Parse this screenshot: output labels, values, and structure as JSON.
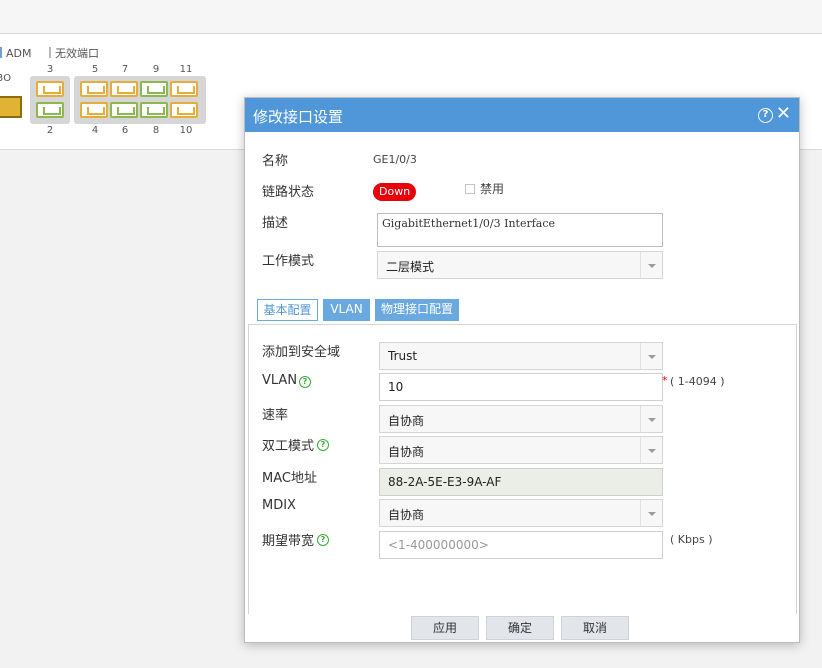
{
  "background": {
    "legend": {
      "adm": "ADM",
      "invalid_port": "无效端口",
      "partial_label": "3O"
    },
    "top_numbers": [
      "3",
      "5",
      "7",
      "9",
      "11"
    ],
    "bottom_numbers": [
      "2",
      "4",
      "6",
      "8",
      "10"
    ]
  },
  "dialog": {
    "title": "修改接口设置",
    "help_icon": "?",
    "close_icon": "✕",
    "name_label": "名称",
    "name_value": "GE1/0/3",
    "link_status_label": "链路状态",
    "link_status_badge": "Down",
    "disable_label": "禁用",
    "description_label": "描述",
    "description_value": "GigabitEthernet1/0/3 Interface",
    "work_mode_label": "工作模式",
    "work_mode_value": "二层模式",
    "tabs": [
      "基本配置",
      "VLAN",
      "物理接口配置"
    ],
    "fields": {
      "security_zone_label": "添加到安全域",
      "security_zone_value": "Trust",
      "vlan_label": "VLAN",
      "vlan_value": "10",
      "vlan_hint": "( 1-4094 )",
      "required_mark": "*",
      "speed_label": "速率",
      "speed_value": "自协商",
      "duplex_label": "双工模式",
      "duplex_value": "自协商",
      "mac_label": "MAC地址",
      "mac_value": "88-2A-5E-E3-9A-AF",
      "mdix_label": "MDIX",
      "mdix_value": "自协商",
      "bandwidth_label": "期望带宽",
      "bandwidth_placeholder": "<1-400000000>",
      "bandwidth_unit": "( Kbps )",
      "help_glyph": "?"
    },
    "buttons": {
      "apply": "应用",
      "ok": "确定",
      "cancel": "取消"
    }
  },
  "colors": {
    "header": "#4f97d8",
    "down_badge": "#e8000b",
    "help_green": "#3aab35",
    "port_orange": "#e5ad3a",
    "port_green": "#8bb950"
  }
}
